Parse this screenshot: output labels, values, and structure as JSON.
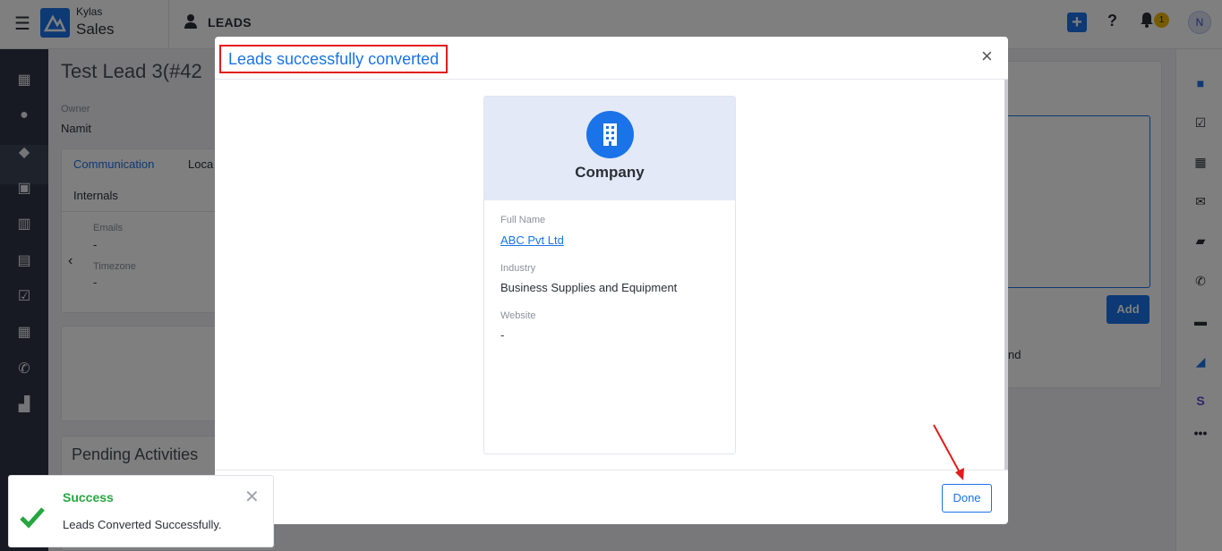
{
  "header": {
    "brand_top": "Kylas",
    "brand_bottom": "Sales",
    "page_title": "LEADS",
    "notification_count": "1",
    "avatar_initial": "N"
  },
  "background": {
    "lead_title": "Test Lead 3(#42",
    "owner_label": "Owner",
    "owner_value": "Namit",
    "tab_communication": "Communication",
    "tab_location": "Loca",
    "tab_internals": "Internals",
    "emails_label": "Emails",
    "emails_value": "-",
    "timezone_label": "Timezone",
    "timezone_value": "-",
    "pending_activities": "Pending Activities",
    "add_button": "Add",
    "partial_text": "nd"
  },
  "modal": {
    "title": "Leads successfully converted",
    "close_symbol": "×",
    "entity_title": "Company",
    "fields": [
      {
        "label": "Full Name",
        "value": "ABC Pvt Ltd"
      },
      {
        "label": "Industry",
        "value": "Business Supplies and Equipment"
      },
      {
        "label": "Website",
        "value": "-"
      }
    ],
    "done_button": "Done"
  },
  "toast": {
    "title": "Success",
    "message": "Leads Converted Successfully.",
    "close_symbol": "✕"
  },
  "colors": {
    "accent": "#1a73e8",
    "success": "#26a641",
    "highlight_box": "#e31b1b"
  }
}
